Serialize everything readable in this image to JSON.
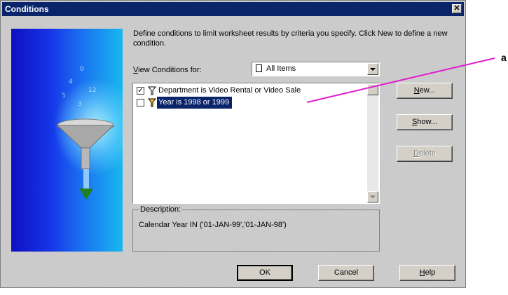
{
  "window": {
    "title": "Conditions",
    "close_glyph": "✕"
  },
  "instructions": "Define conditions to limit worksheet results by criteria you specify. Click New to define a new condition.",
  "view_for": {
    "label_prefix": "V",
    "label_rest": "iew Conditions for:",
    "selected": "All Items",
    "icon": "document-icon"
  },
  "conditions": [
    {
      "checked": true,
      "check_glyph": "✓",
      "text": "Department is Video Rental or Video Sale",
      "icon": "funnel-icon",
      "selected": false
    },
    {
      "checked": false,
      "check_glyph": "",
      "text": "Year is 1998 or 1999",
      "icon": "funnel-icon",
      "selected": true
    }
  ],
  "description": {
    "label": "Description:",
    "text": "Calendar Year IN ('01-JAN-99','01-JAN-98')"
  },
  "buttons": {
    "new": {
      "ul": "N",
      "rest": "ew..."
    },
    "show": {
      "ul": "S",
      "rest": "how..."
    },
    "delete": {
      "ul": "D",
      "rest": "elete"
    },
    "ok": "OK",
    "cancel": "Cancel",
    "help": {
      "ul": "H",
      "rest": "elp"
    }
  },
  "callout": {
    "label": "a",
    "color": "#e020d0"
  },
  "colors": {
    "title_bar": "#0a246a",
    "selection": "#0a246a",
    "dialog_bg": "#c8c8c8"
  }
}
